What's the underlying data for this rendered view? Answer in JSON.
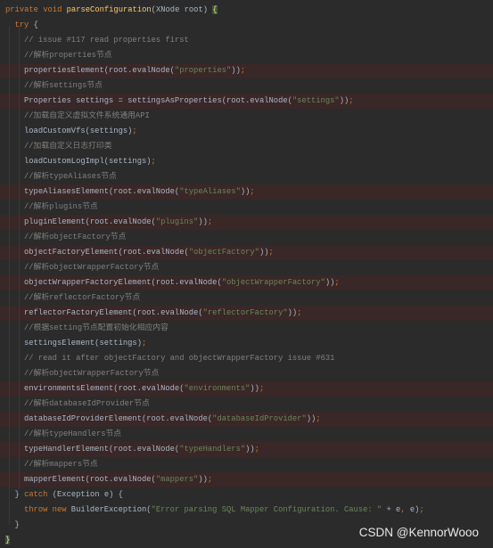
{
  "colors": {
    "background": "#2b2b2b",
    "keyword": "#cc7832",
    "method_declaration": "#ffc66d",
    "text": "#a9b7c6",
    "comment": "#808080",
    "string": "#6a8759",
    "highlighted_line": "#3a2727"
  },
  "watermark": "CSDN @KennorWooo",
  "lines": [
    {
      "indent": 0,
      "hl": false,
      "tokens": [
        [
          "kw",
          "private void "
        ],
        [
          "decl",
          "parseConfiguration"
        ],
        [
          "txt",
          "(XNode root) "
        ],
        [
          "brace-hl",
          "{"
        ]
      ]
    },
    {
      "indent": 1,
      "hl": false,
      "tokens": [
        [
          "kw",
          "try "
        ],
        [
          "txt",
          "{"
        ]
      ]
    },
    {
      "indent": 2,
      "hl": false,
      "tokens": [
        [
          "cm",
          "// issue #117 read properties first"
        ]
      ]
    },
    {
      "indent": 2,
      "hl": false,
      "tokens": [
        [
          "cm",
          "//解析properties节点"
        ]
      ]
    },
    {
      "indent": 2,
      "hl": true,
      "tokens": [
        [
          "txt",
          "propertiesElement(root.evalNode("
        ],
        [
          "str",
          "\"properties\""
        ],
        [
          "txt",
          "))"
        ],
        [
          "kw",
          ";"
        ]
      ]
    },
    {
      "indent": 2,
      "hl": false,
      "tokens": [
        [
          "cm",
          "//解析settings节点"
        ]
      ]
    },
    {
      "indent": 2,
      "hl": true,
      "tokens": [
        [
          "txt",
          "Properties settings = settingsAsProperties(root.evalNode("
        ],
        [
          "str",
          "\"settings\""
        ],
        [
          "txt",
          "))"
        ],
        [
          "kw",
          ";"
        ]
      ]
    },
    {
      "indent": 2,
      "hl": false,
      "tokens": [
        [
          "cm",
          "//加载自定义虚拟文件系统通用API"
        ]
      ]
    },
    {
      "indent": 2,
      "hl": false,
      "tokens": [
        [
          "txt",
          "loadCustomVfs(settings)"
        ],
        [
          "kw",
          ";"
        ]
      ]
    },
    {
      "indent": 2,
      "hl": false,
      "tokens": [
        [
          "cm",
          "//加载自定义日志打印类"
        ]
      ]
    },
    {
      "indent": 2,
      "hl": false,
      "tokens": [
        [
          "txt",
          "loadCustomLogImpl(settings)"
        ],
        [
          "kw",
          ";"
        ]
      ]
    },
    {
      "indent": 2,
      "hl": false,
      "tokens": [
        [
          "cm",
          "//解析typeAliases节点"
        ]
      ]
    },
    {
      "indent": 2,
      "hl": true,
      "tokens": [
        [
          "txt",
          "typeAliasesElement(root.evalNode("
        ],
        [
          "str",
          "\"typeAliases\""
        ],
        [
          "txt",
          "))"
        ],
        [
          "kw",
          ";"
        ]
      ]
    },
    {
      "indent": 2,
      "hl": false,
      "tokens": [
        [
          "cm",
          "//解析plugins节点"
        ]
      ]
    },
    {
      "indent": 2,
      "hl": true,
      "tokens": [
        [
          "txt",
          "pluginElement(root.evalNode("
        ],
        [
          "str",
          "\"plugins\""
        ],
        [
          "txt",
          "))"
        ],
        [
          "kw",
          ";"
        ]
      ]
    },
    {
      "indent": 2,
      "hl": false,
      "tokens": [
        [
          "cm",
          "//解析objectFactory节点"
        ]
      ]
    },
    {
      "indent": 2,
      "hl": true,
      "tokens": [
        [
          "txt",
          "objectFactoryElement(root.evalNode("
        ],
        [
          "str",
          "\"objectFactory\""
        ],
        [
          "txt",
          "))"
        ],
        [
          "kw",
          ";"
        ]
      ]
    },
    {
      "indent": 2,
      "hl": false,
      "tokens": [
        [
          "cm",
          "//解析objectWrapperFactory节点"
        ]
      ]
    },
    {
      "indent": 2,
      "hl": true,
      "tokens": [
        [
          "txt",
          "objectWrapperFactoryElement(root.evalNode("
        ],
        [
          "str",
          "\"objectWrapperFactory\""
        ],
        [
          "txt",
          "))"
        ],
        [
          "kw",
          ";"
        ]
      ]
    },
    {
      "indent": 2,
      "hl": false,
      "tokens": [
        [
          "cm",
          "//解析reflectorFactory节点"
        ]
      ]
    },
    {
      "indent": 2,
      "hl": true,
      "tokens": [
        [
          "txt",
          "reflectorFactoryElement(root.evalNode("
        ],
        [
          "str",
          "\"reflectorFactory\""
        ],
        [
          "txt",
          "))"
        ],
        [
          "kw",
          ";"
        ]
      ]
    },
    {
      "indent": 2,
      "hl": false,
      "tokens": [
        [
          "cm",
          "//根据setting节点配置初始化相应内容"
        ]
      ]
    },
    {
      "indent": 2,
      "hl": false,
      "tokens": [
        [
          "txt",
          "settingsElement(settings)"
        ],
        [
          "kw",
          ";"
        ]
      ]
    },
    {
      "indent": 2,
      "hl": false,
      "tokens": [
        [
          "cm",
          "// read it after objectFactory and objectWrapperFactory issue #631"
        ]
      ]
    },
    {
      "indent": 2,
      "hl": false,
      "tokens": [
        [
          "cm",
          "//解析objectWrapperFactory节点"
        ]
      ]
    },
    {
      "indent": 2,
      "hl": true,
      "tokens": [
        [
          "txt",
          "environmentsElement(root.evalNode("
        ],
        [
          "str",
          "\"environments\""
        ],
        [
          "txt",
          "))"
        ],
        [
          "kw",
          ";"
        ]
      ]
    },
    {
      "indent": 2,
      "hl": false,
      "tokens": [
        [
          "cm",
          "//解析databaseIdProvider节点"
        ]
      ]
    },
    {
      "indent": 2,
      "hl": true,
      "tokens": [
        [
          "txt",
          "databaseIdProviderElement(root.evalNode("
        ],
        [
          "str",
          "\"databaseIdProvider\""
        ],
        [
          "txt",
          "))"
        ],
        [
          "kw",
          ";"
        ]
      ]
    },
    {
      "indent": 2,
      "hl": false,
      "tokens": [
        [
          "cm",
          "//解析typeHandlers节点"
        ]
      ]
    },
    {
      "indent": 2,
      "hl": true,
      "tokens": [
        [
          "txt",
          "typeHandlerElement(root.evalNode("
        ],
        [
          "str",
          "\"typeHandlers\""
        ],
        [
          "txt",
          "))"
        ],
        [
          "kw",
          ";"
        ]
      ]
    },
    {
      "indent": 2,
      "hl": false,
      "tokens": [
        [
          "cm",
          "//解析mappers节点"
        ]
      ]
    },
    {
      "indent": 2,
      "hl": true,
      "tokens": [
        [
          "txt",
          "mapperElement(root.evalNode("
        ],
        [
          "str",
          "\"mappers\""
        ],
        [
          "txt",
          "))"
        ],
        [
          "kw",
          ";"
        ]
      ]
    },
    {
      "indent": 1,
      "hl": false,
      "tokens": [
        [
          "txt",
          "} "
        ],
        [
          "kw",
          "catch "
        ],
        [
          "txt",
          "(Exception e) {"
        ]
      ]
    },
    {
      "indent": 2,
      "hl": false,
      "tokens": [
        [
          "kw",
          "throw new "
        ],
        [
          "txt",
          "BuilderException("
        ],
        [
          "str",
          "\"Error parsing SQL Mapper Configuration. Cause: \""
        ],
        [
          "txt",
          " + e"
        ],
        [
          "kw",
          ", "
        ],
        [
          "txt",
          "e)"
        ],
        [
          "kw",
          ";"
        ]
      ]
    },
    {
      "indent": 1,
      "hl": false,
      "tokens": [
        [
          "txt",
          "}"
        ]
      ]
    },
    {
      "indent": 0,
      "hl": false,
      "tokens": [
        [
          "brace-hl",
          "}"
        ]
      ]
    }
  ]
}
